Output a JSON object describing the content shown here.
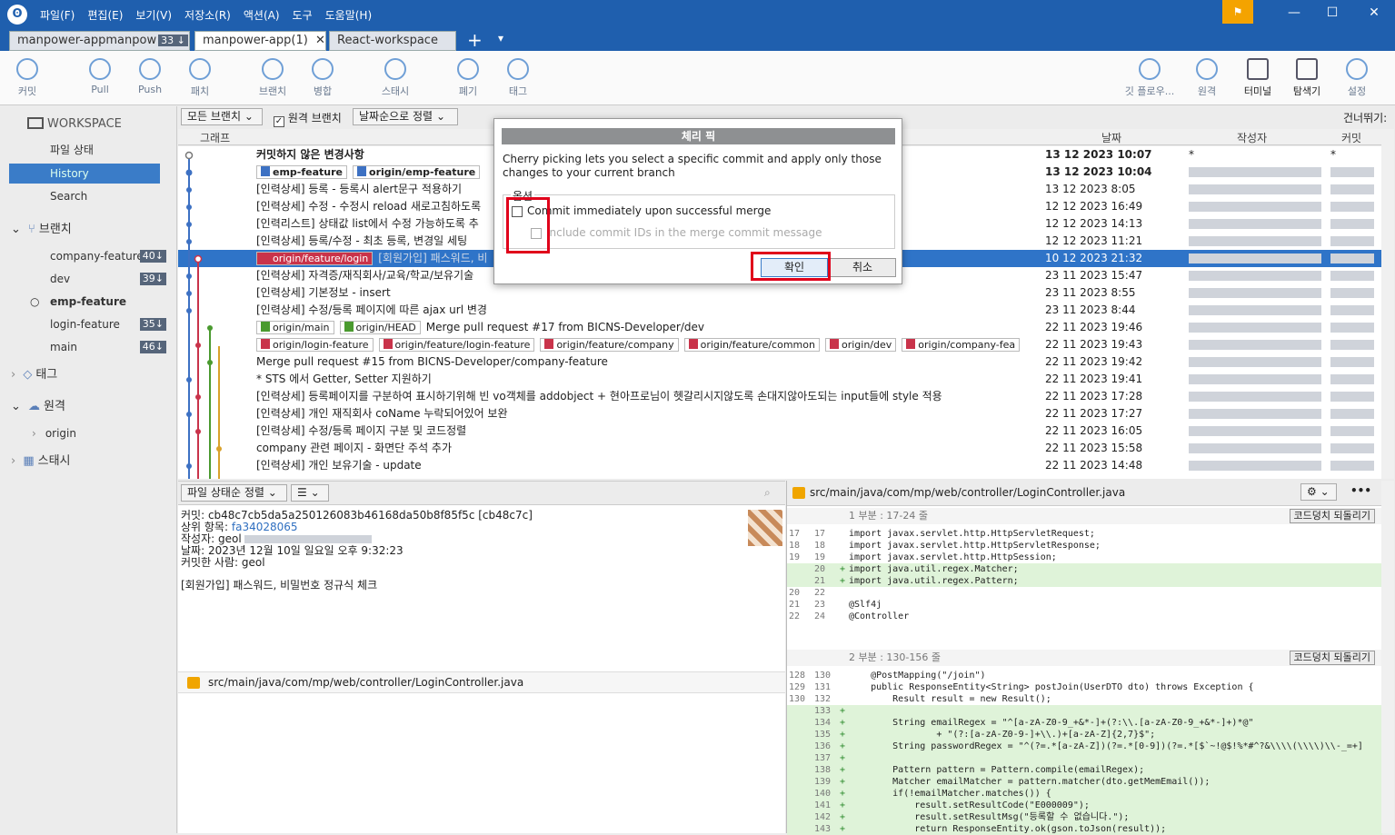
{
  "menu": [
    "파일(F)",
    "편집(E)",
    "보기(V)",
    "저장소(R)",
    "액션(A)",
    "도구",
    "도움말(H)"
  ],
  "tabs": [
    {
      "label": "manpower-appmanpow",
      "badge": "33 ↓"
    },
    {
      "label": "manpower-app(1)",
      "close": "✕"
    },
    {
      "label": "React-workspace"
    }
  ],
  "tab_add": "+",
  "tab_menu": "▾",
  "toolbar_left": [
    {
      "label": "커밋",
      "icon": "plus-icon"
    },
    {
      "label": "Pull",
      "icon": "pull-icon"
    },
    {
      "label": "Push",
      "icon": "push-icon"
    },
    {
      "label": "패치",
      "icon": "patch-icon"
    },
    {
      "label": "브랜치",
      "icon": "branch-icon"
    },
    {
      "label": "병합",
      "icon": "merge-icon"
    },
    {
      "label": "스태시",
      "icon": "stash-icon"
    },
    {
      "label": "폐기",
      "icon": "discard-icon"
    },
    {
      "label": "태그",
      "icon": "tag-icon"
    }
  ],
  "toolbar_right": [
    {
      "label": "깃 플로우...",
      "icon": "git-flow-icon"
    },
    {
      "label": "원격",
      "icon": "remote-icon"
    },
    {
      "label": "터미널",
      "icon": "terminal-icon"
    },
    {
      "label": "탐색기",
      "icon": "explorer-icon"
    },
    {
      "label": "설정",
      "icon": "settings-icon"
    }
  ],
  "sidebar": {
    "workspace": "WORKSPACE",
    "file_status": "파일 상태",
    "history": "History",
    "search": "Search",
    "branches_title": "브랜치",
    "branches": [
      {
        "name": "company-feature",
        "count": "40↓"
      },
      {
        "name": "dev",
        "count": "39↓"
      },
      {
        "name": "emp-feature",
        "count": ""
      },
      {
        "name": "login-feature",
        "count": "35↓"
      },
      {
        "name": "main",
        "count": "46↓"
      }
    ],
    "tags_title": "태그",
    "remotes_title": "원격",
    "remote_origin": "origin",
    "stash_title": "스태시"
  },
  "filters": {
    "branches": "모든 브랜치",
    "remote": "원격 브랜치",
    "sort": "날짜순으로 정렬",
    "skip": "건너뛰기:"
  },
  "columns": {
    "graph": "그래프",
    "desc": "설명",
    "date": "날짜",
    "author": "작성자",
    "commit": "커밋"
  },
  "commits": [
    {
      "msg": "커밋하지 않은 변경사항",
      "date": "13 12 2023 10:07",
      "author": "*",
      "hash": "*",
      "bold": true
    },
    {
      "labels": [
        {
          "t": "emp-feature",
          "c": "blue"
        },
        {
          "t": "origin/emp-feature",
          "c": "blue"
        }
      ],
      "msg": "",
      "date": "13 12 2023 10:04",
      "bold": true
    },
    {
      "msg": "[인력상세] 등록 - 등록시 alert문구 적용하기",
      "date": "13 12 2023 8:05"
    },
    {
      "msg": "[인력상세] 수정 - 수정시 reload 새로고침하도록",
      "date": "12 12 2023 16:49"
    },
    {
      "msg": "[인력리스트] 상태값 list에서 수정 가능하도록 추",
      "date": "12 12 2023 14:13"
    },
    {
      "msg": "[인력상세] 등록/수정 - 최초 등록, 변경일 세팅",
      "date": "12 12 2023 11:21"
    },
    {
      "labels": [
        {
          "t": "origin/feature/login",
          "c": "red"
        }
      ],
      "msg": "[회원가입] 패스워드, 비",
      "date": "10 12 2023 21:32",
      "selected": true
    },
    {
      "msg": "[인력상세] 자격증/재직회사/교육/학교/보유기술",
      "date": "23 11 2023 15:47"
    },
    {
      "msg": "[인력상세] 기본정보 - insert",
      "date": "23 11 2023 8:55"
    },
    {
      "msg": "[인력상세] 수정/등록 페이지에 따른 ajax url 변경",
      "date": "23 11 2023 8:44"
    },
    {
      "labels": [
        {
          "t": "origin/main",
          "c": "green"
        },
        {
          "t": "origin/HEAD",
          "c": "green"
        }
      ],
      "msg": "Merge pull request #17 from BICNS-Developer/dev",
      "date": "22 11 2023 19:46"
    },
    {
      "labels": [
        {
          "t": "origin/login-feature",
          "c": "red"
        },
        {
          "t": "origin/feature/login-feature",
          "c": "red"
        },
        {
          "t": "origin/feature/company",
          "c": "red"
        },
        {
          "t": "origin/feature/common",
          "c": "red"
        },
        {
          "t": "origin/dev",
          "c": "red"
        },
        {
          "t": "origin/company-fea",
          "c": "red"
        }
      ],
      "msg": "",
      "date": "22 11 2023 19:43"
    },
    {
      "msg": "Merge pull request #15 from BICNS-Developer/company-feature",
      "date": "22 11 2023 19:42"
    },
    {
      "msg": "* STS 에서 Getter, Setter 지원하기",
      "date": "22 11 2023 19:41"
    },
    {
      "msg": "[인력상세] 등록페이지를 구분하여 표시하기위해 빈 vo객체를 addobject + 현아프로님이 헷갈리시지않도록 손대지않아도되는 input들에 style 적용",
      "date": "22 11 2023 17:28"
    },
    {
      "msg": "[인력상세] 개인 재직회사 coName 누락되어있어 보완",
      "date": "22 11 2023 17:27"
    },
    {
      "msg": "[인력상세] 수정/등록 페이지 구분 및 코드정렬",
      "date": "22 11 2023 16:05"
    },
    {
      "msg": "company 관련 페이지 - 화면단 주석 추가",
      "date": "22 11 2023 15:58"
    },
    {
      "msg": "[인력상세] 개인 보유기술 - update",
      "date": "22 11 2023 14:48"
    }
  ],
  "dialog": {
    "title": "체리 픽",
    "desc": "Cherry picking lets you select a specific commit and apply only those changes to your current branch",
    "options_label": "옵션",
    "opt1": "Commit immediately upon successful merge",
    "opt2": "Include commit IDs in the merge commit message",
    "ok": "확인",
    "cancel": "취소"
  },
  "bottom_left": {
    "sort": "파일 상태순 정렬",
    "view": "☰",
    "commit_line": "커밋: cb48c7cb5da5a250126083b46168da50b8f85f5c [cb48c7c]",
    "parent_label": "상위 항목:",
    "parent_hash": "fa34028065",
    "author_line": "작성자: geol",
    "date_line": "날짜: 2023년 12월 10일 일요일 오후 9:32:23",
    "committer_line": "커밋한 사람: geol",
    "message": "[회원가입] 패스워드, 비밀번호 정규식 체크",
    "file": "src/main/java/com/mp/web/controller/LoginController.java"
  },
  "bottom_right": {
    "file": "src/main/java/com/mp/web/controller/LoginController.java",
    "hunk1": "1 부분 : 17-24 줄",
    "hunk2": "2 부분 : 130-156 줄",
    "revert": "코드덩치 되돌리기",
    "lines1": [
      {
        "a": "17",
        "b": "17",
        "s": "",
        "t": "import javax.servlet.http.HttpServletRequest;"
      },
      {
        "a": "18",
        "b": "18",
        "s": "",
        "t": "import javax.servlet.http.HttpServletResponse;"
      },
      {
        "a": "19",
        "b": "19",
        "s": "",
        "t": "import javax.servlet.http.HttpSession;"
      },
      {
        "a": "",
        "b": "20",
        "s": "+",
        "t": "import java.util.regex.Matcher;",
        "add": true
      },
      {
        "a": "",
        "b": "21",
        "s": "+",
        "t": "import java.util.regex.Pattern;",
        "add": true
      },
      {
        "a": "20",
        "b": "22",
        "s": "",
        "t": ""
      },
      {
        "a": "21",
        "b": "23",
        "s": "",
        "t": "@Slf4j"
      },
      {
        "a": "22",
        "b": "24",
        "s": "",
        "t": "@Controller"
      }
    ],
    "lines2": [
      {
        "a": "128",
        "b": "130",
        "s": "",
        "t": "    @PostMapping(\"/join\")"
      },
      {
        "a": "129",
        "b": "131",
        "s": "",
        "t": "    public ResponseEntity<String> postJoin(UserDTO dto) throws Exception {"
      },
      {
        "a": "130",
        "b": "132",
        "s": "",
        "t": "        Result result = new Result();"
      },
      {
        "a": "",
        "b": "133",
        "s": "+",
        "t": "",
        "add": true
      },
      {
        "a": "",
        "b": "134",
        "s": "+",
        "t": "        String emailRegex = \"^[a-zA-Z0-9_+&*-]+(?:\\\\.[a-zA-Z0-9_+&*-]+)*@\"",
        "add": true
      },
      {
        "a": "",
        "b": "135",
        "s": "+",
        "t": "                + \"(?:[a-zA-Z0-9-]+\\\\.)+[a-zA-Z]{2,7}$\";",
        "add": true
      },
      {
        "a": "",
        "b": "136",
        "s": "+",
        "t": "        String passwordRegex = \"^(?=.*[a-zA-Z])(?=.*[0-9])(?=.*[$`~!@$!%*#^?&\\\\\\\\(\\\\\\\\)\\\\-_=+]",
        "add": true
      },
      {
        "a": "",
        "b": "137",
        "s": "+",
        "t": "",
        "add": true
      },
      {
        "a": "",
        "b": "138",
        "s": "+",
        "t": "        Pattern pattern = Pattern.compile(emailRegex);",
        "add": true
      },
      {
        "a": "",
        "b": "139",
        "s": "+",
        "t": "        Matcher emailMatcher = pattern.matcher(dto.getMemEmail());",
        "add": true
      },
      {
        "a": "",
        "b": "140",
        "s": "+",
        "t": "        if(!emailMatcher.matches()) {",
        "add": true
      },
      {
        "a": "",
        "b": "141",
        "s": "+",
        "t": "            result.setResultCode(\"E000009\");",
        "add": true
      },
      {
        "a": "",
        "b": "142",
        "s": "+",
        "t": "            result.setResultMsg(\"등록할 수 없습니다.\");",
        "add": true
      },
      {
        "a": "",
        "b": "143",
        "s": "+",
        "t": "            return ResponseEntity.ok(gson.toJson(result));",
        "add": true
      }
    ]
  }
}
